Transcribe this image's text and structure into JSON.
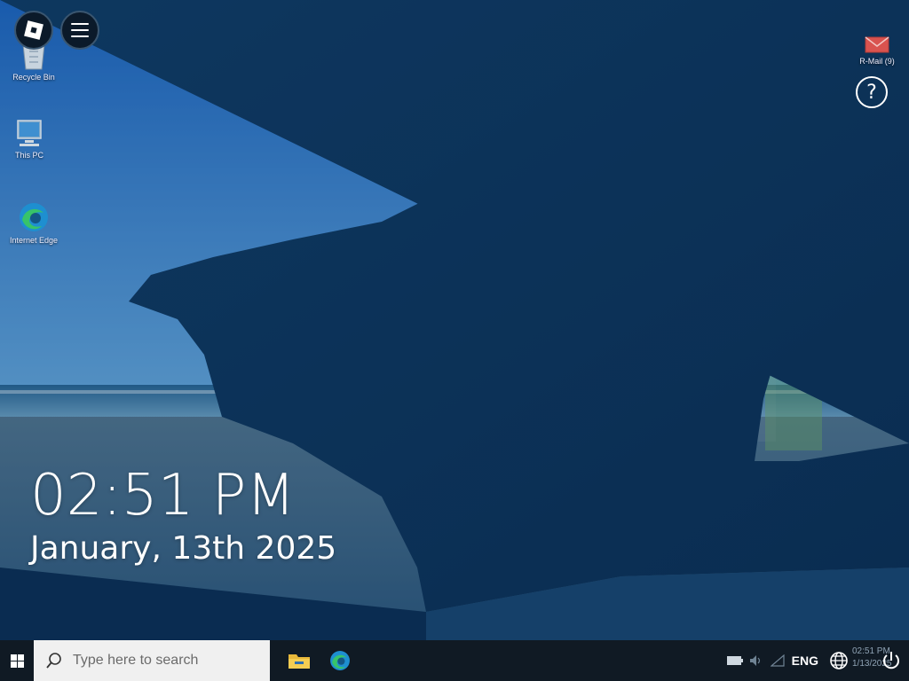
{
  "desktop": {
    "icons": [
      {
        "label": "Recycle Bin"
      },
      {
        "label": "This PC"
      },
      {
        "label": "Internet Edge"
      },
      {
        "label": "R-Mail (9)"
      }
    ],
    "help_label": "?"
  },
  "clock": {
    "time": "02:51 PM",
    "date": "January, 13th 2025"
  },
  "taskbar": {
    "search_placeholder": "Type here to search",
    "apps": [
      {
        "icon": "file-explorer-icon"
      },
      {
        "icon": "edge-icon"
      }
    ],
    "tray": {
      "language": "ENG",
      "time": "02:51 PM",
      "date": "1/13/2025"
    }
  },
  "colors": {
    "taskbar": "#101a24",
    "search_bg": "#f0f0f0",
    "sky": "#2f7fd1"
  }
}
